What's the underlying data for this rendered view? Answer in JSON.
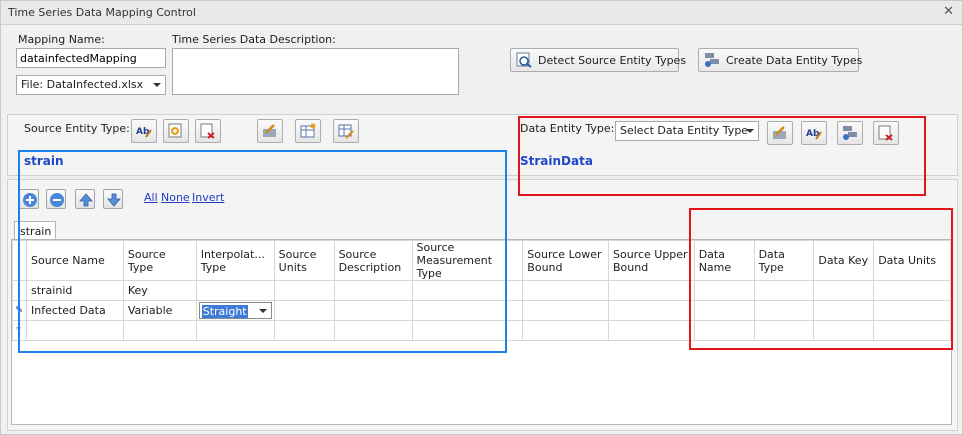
{
  "window": {
    "title": "Time Series Data Mapping Control"
  },
  "mapping": {
    "name_label": "Mapping Name:",
    "name_value": "datainfectedMapping",
    "file_value": "File: DataInfected.xlsx",
    "description_label": "Time Series Data Description:",
    "description_value": ""
  },
  "top_buttons": {
    "detect": "Detect Source Entity Types",
    "create": "Create Data Entity Types"
  },
  "source": {
    "label": "Source Entity Type:",
    "entity": "strain"
  },
  "data_entity": {
    "label": "Data Entity Type:",
    "select_value": "Select Data Entity Type",
    "entity": "StrainData"
  },
  "filters": {
    "all": "All",
    "none": "None",
    "invert": "Invert"
  },
  "tab": "strain",
  "grid": {
    "columns": [
      "Source Name",
      "Source Type",
      "Interpolat... Type",
      "Source Units",
      "Source Description",
      "Source Measurement Type",
      "Source Lower Bound",
      "Source Upper Bound",
      "Data Name",
      "Data Type",
      "Data Key",
      "Data Units"
    ],
    "rows": [
      {
        "source_name": "strainid",
        "source_type": "Key",
        "interp": ""
      },
      {
        "source_name": "Infected Data",
        "source_type": "Variable",
        "interp": "Straight"
      }
    ]
  },
  "colors": {
    "highlight_blue": "#1e7ff0",
    "highlight_red": "#e0161a",
    "entity_text": "#1f48c8"
  }
}
